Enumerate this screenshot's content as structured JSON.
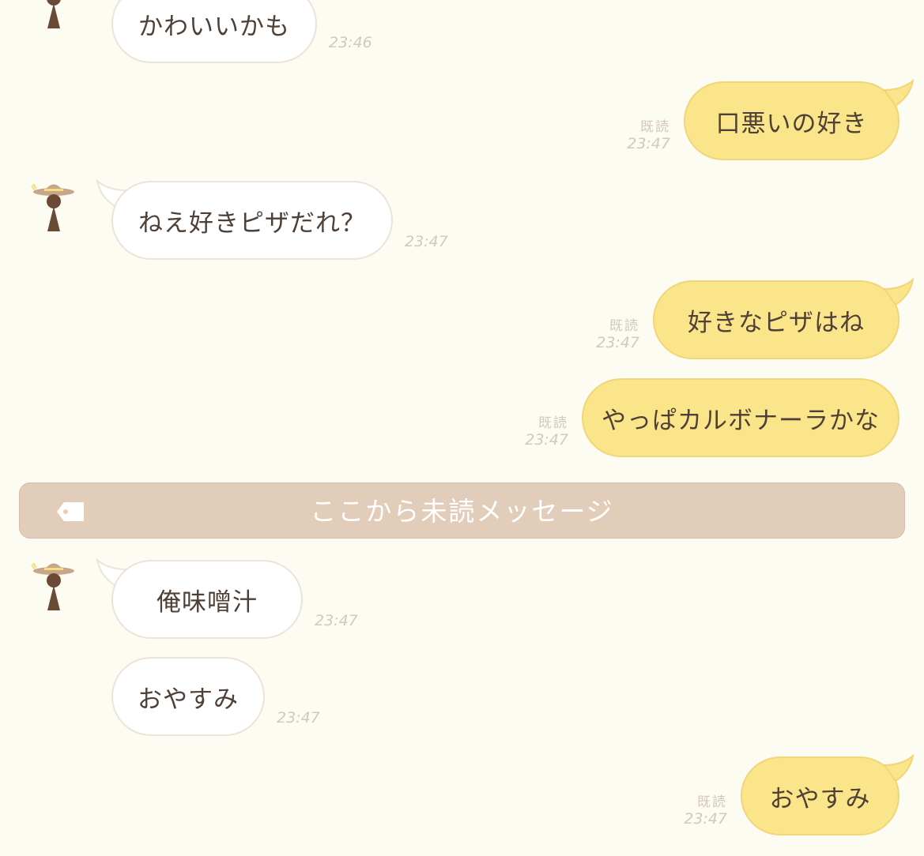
{
  "colors": {
    "background": "#fdfcf2",
    "incoming_bubble": "#ffffff",
    "outgoing_bubble": "#fbe58a",
    "unread_divider": "#e1cdb9"
  },
  "messages": [
    {
      "direction": "in",
      "text": "かわいいかも",
      "time": "23:46"
    },
    {
      "direction": "out",
      "text": "口悪いの好き",
      "read": "既読",
      "time": "23:47"
    },
    {
      "direction": "in",
      "text": "ねえ好きピザだれ？",
      "time": "23:47"
    },
    {
      "direction": "out",
      "text": "好きなピザはね",
      "read": "既読",
      "time": "23:47"
    },
    {
      "direction": "out",
      "text": "やっぱカルボナーラかな",
      "read": "既読",
      "time": "23:47"
    },
    {
      "direction": "in",
      "text": "俺味噌汁",
      "time": "23:47"
    },
    {
      "direction": "in",
      "text": "おやすみ",
      "time": "23:47"
    },
    {
      "direction": "out",
      "text": "おやすみ",
      "read": "既読",
      "time": "23:47"
    }
  ],
  "unread_divider": {
    "label": "ここから未読メッセージ",
    "icon": "tag-icon"
  },
  "contact": {
    "avatar_icon": "girl-with-straw-hat-avatar"
  }
}
